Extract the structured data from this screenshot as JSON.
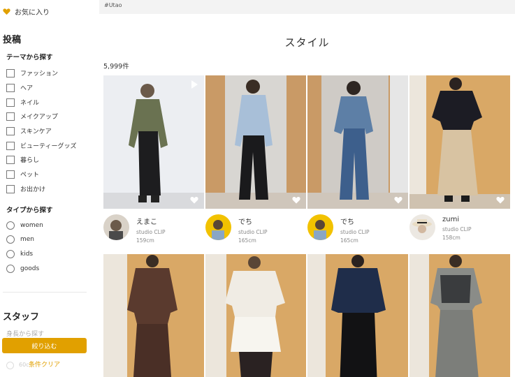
{
  "sidebar": {
    "favorites": "お気に入り",
    "posts_title": "投稿",
    "theme_title": "テーマから探す",
    "themes": [
      "ファッション",
      "ヘア",
      "ネイル",
      "メイクアップ",
      "スキンケア",
      "ビューティーグッズ",
      "暮らし",
      "ペット",
      "お出かけ"
    ],
    "type_title": "タイプから探す",
    "types": [
      "women",
      "men",
      "kids",
      "goods"
    ],
    "staff_title": "スタッフ",
    "height_hint": "身長から探す",
    "narrow_button": "絞り込む",
    "partial_option": "60c",
    "clear_link": "条件クリア"
  },
  "main": {
    "hashtag": "#Utao",
    "title": "スタイル",
    "count": "5,999件",
    "cards": [
      {
        "name": "えまこ",
        "shop": "studio CLIP",
        "height": "159cm"
      },
      {
        "name": "でち",
        "shop": "studio CLIP",
        "height": "165cm"
      },
      {
        "name": "でち",
        "shop": "studio CLIP",
        "height": "165cm"
      },
      {
        "name": "zumi",
        "shop": "studio CLIP",
        "height": "158cm"
      }
    ]
  },
  "colors": {
    "accent": "#e1a000",
    "tag_bg": "#f3f3f3"
  }
}
